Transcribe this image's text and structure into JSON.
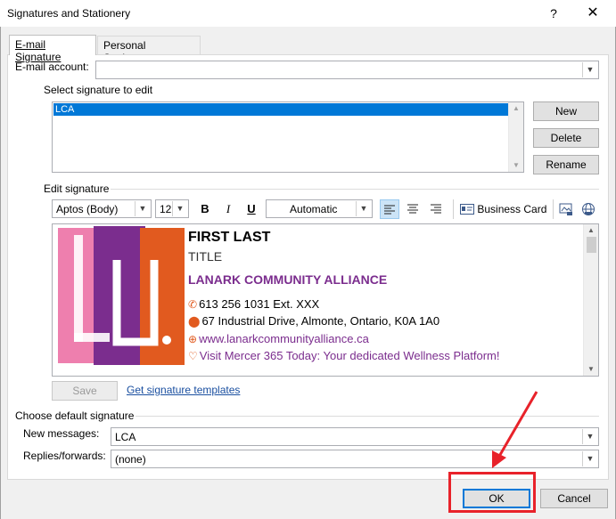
{
  "window": {
    "title": "Signatures and Stationery",
    "help_glyph": "?",
    "close_glyph": "✕"
  },
  "tabs": [
    {
      "label": "E-mail Signature",
      "active": true
    },
    {
      "label": "Personal Stationery",
      "active": false
    }
  ],
  "email_account": {
    "label": "E-mail account:",
    "value": ""
  },
  "select_signature": {
    "label": "Select signature to edit",
    "items": [
      "LCA"
    ],
    "selected": "LCA"
  },
  "buttons": {
    "new": "New",
    "delete": "Delete",
    "rename": "Rename",
    "save": "Save",
    "ok": "OK",
    "cancel": "Cancel"
  },
  "edit_signature": {
    "label": "Edit signature",
    "font": "Aptos (Body)",
    "size": "12",
    "bold": "B",
    "italic": "I",
    "underline": "U",
    "color": "Automatic",
    "business_card": "Business Card"
  },
  "signature": {
    "name": "FIRST LAST",
    "title": "TITLE",
    "org": "LANARK COMMUNITY ALLIANCE",
    "phone": "613 256 1031 Ext. XXX",
    "address": "67 Industrial Drive, Almonte, Ontario, K0A 1A0",
    "website": "www.lanarkcommunityalliance.ca",
    "wellness": "Visit Mercer 365 Today: Your dedicated Wellness Platform!",
    "logo_colors": [
      "#ee7fae",
      "#7b2d8e",
      "#e15a1f"
    ]
  },
  "templates_link": "Get signature templates",
  "default_signature": {
    "label": "Choose default signature",
    "new_messages_label": "New messages:",
    "new_messages_value": "LCA",
    "replies_label": "Replies/forwards:",
    "replies_value": "(none)"
  },
  "colors": {
    "selection": "#0078d7",
    "link": "#1a4fa0",
    "annotation": "#e8222a"
  }
}
